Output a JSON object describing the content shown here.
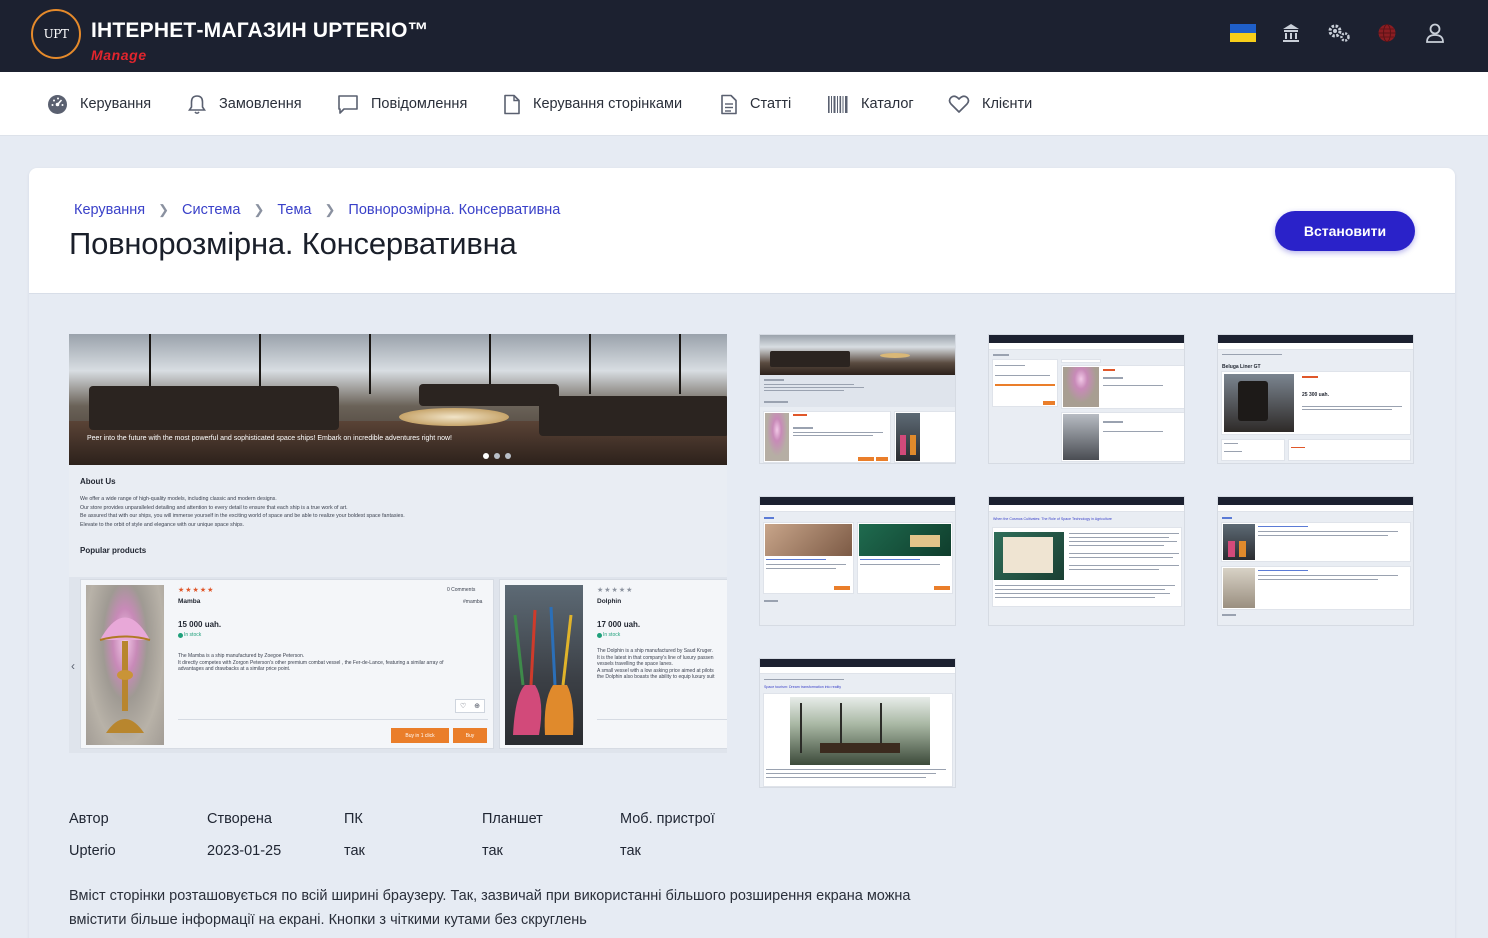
{
  "header": {
    "logo_text": "UPT",
    "title": "ІНТЕРНЕТ-МАГАЗИН UPTERIO™",
    "subtitle": "Manage",
    "icons": [
      "ukraine-flag-icon",
      "bank-icon",
      "gears-icon",
      "globe-icon",
      "user-icon"
    ],
    "accent_color": "#e58a2b",
    "subtitle_color": "#e1252d"
  },
  "nav": {
    "items": [
      {
        "label": "Керування",
        "icon": "dashboard-icon"
      },
      {
        "label": "Замовлення",
        "icon": "bell-icon"
      },
      {
        "label": "Повідомлення",
        "icon": "message-icon"
      },
      {
        "label": "Керування сторінками",
        "icon": "page-icon"
      },
      {
        "label": "Статті",
        "icon": "document-icon"
      },
      {
        "label": "Каталог",
        "icon": "barcode-icon"
      },
      {
        "label": "Клієнти",
        "icon": "heart-icon"
      }
    ]
  },
  "breadcrumb": [
    "Керування",
    "Система",
    "Тема",
    "Повнорозмірна. Консервативна"
  ],
  "page": {
    "title": "Повнорозмірна. Консервативна",
    "install_button": "Встановити",
    "button_color": "#2a22c9"
  },
  "preview": {
    "hero_caption": "Peer into the future with the most powerful and sophisticated space ships! Embark on incredible adventures right now!",
    "about_title": "About Us",
    "about_lines": [
      "We offer a wide range of high-quality models, including classic and modern designs.",
      "Our store provides unparalleled detailing and attention to every detail to ensure that each ship is a true work of art.",
      "Be assured that with our ships, you will immerse yourself in the exciting world of space and be able to realize your boldest space fantasies.",
      "Elevate to the orbit of style and elegance with our unique space ships."
    ],
    "popular_title": "Popular products",
    "products": [
      {
        "stars": "★★★★★",
        "name": "Mamba",
        "comments": "0 Comments",
        "brand": "#mamba",
        "price": "15 000 uah.",
        "stock": "In stock",
        "desc": [
          "The Mamba is a ship manufactured by Zoegoe Peterson.",
          "It directly competes with Zorgon Peterson's other premium combat vessel , the Fer-de-Lance, featuring a similar array of",
          "advantages and drawbacks at a similar price point."
        ],
        "buy_one_click": "Buy in 1 click",
        "buy": "Buy"
      },
      {
        "stars": "★★★★★",
        "name": "Dolphin",
        "price": "17 000 uah.",
        "stock": "In stock",
        "desc": [
          "The Dolphin is a ship manufactured by Saud Kruger.",
          "It is the latest in that company's line of luxury passen",
          "vessels travelling the space lanes.",
          "A small vessel with a low asking price aimed at pilots",
          "the Dolphin also boasts the ability to equip luxury suit"
        ]
      }
    ]
  },
  "thumbnails": [
    {
      "label": "home"
    },
    {
      "label": "catalog"
    },
    {
      "label": "product",
      "title": "Beluga Liner GT",
      "price": "25 300 uah."
    },
    {
      "label": "blog"
    },
    {
      "label": "article",
      "title": "When the Cosmos Cultivates: The Role of Space Technology in Agriculture"
    },
    {
      "label": "news"
    },
    {
      "label": "post",
      "title": "Space tourism: Dream transformation into reality"
    }
  ],
  "meta": {
    "headers": [
      "Автор",
      "Створена",
      "ПК",
      "Планшет",
      "Моб. пристрої"
    ],
    "values": [
      "Upterio",
      "2023-01-25",
      "так",
      "так",
      "так"
    ]
  },
  "description": "Вміст сторінки розташовується по всій ширині браузеру. Так, зазвичай при використанні більшого розширення екрана можна вмістити більше інформації на екрані. Кнопки з чіткими кутами без скруглень"
}
